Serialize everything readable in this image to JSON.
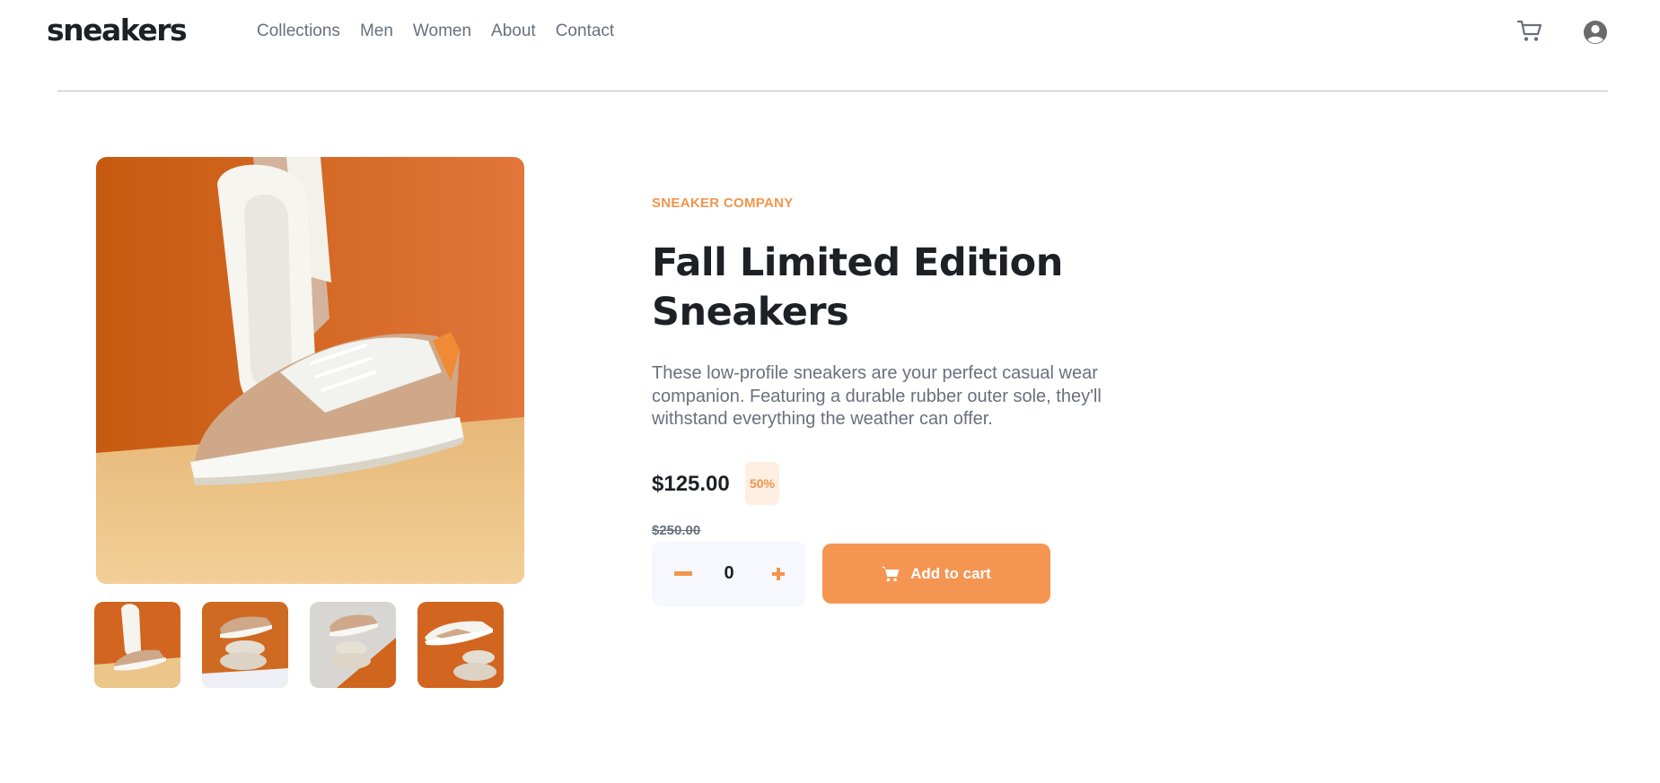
{
  "header": {
    "logo": "sneakers",
    "nav": [
      "Collections",
      "Men",
      "Women",
      "About",
      "Contact"
    ],
    "cart_icon": "cart-icon",
    "avatar_icon": "user-avatar-icon"
  },
  "product": {
    "company": "SNEAKER COMPANY",
    "title": "Fall Limited Edition Sneakers",
    "description": "These low-profile sneakers are your perfect casual wear companion. Featuring a durable rubber outer sole, they'll withstand everything the weather can offer.",
    "price": "$125.00",
    "discount": "50%",
    "original_price": "$250.00",
    "quantity": "0",
    "add_to_cart_label": "Add to cart"
  },
  "gallery": {
    "thumbnail_count": 4
  },
  "colors": {
    "accent": "#f59552",
    "accent_light": "#ffeee2",
    "text_dark": "#1d2025",
    "text_muted": "#69707d"
  }
}
